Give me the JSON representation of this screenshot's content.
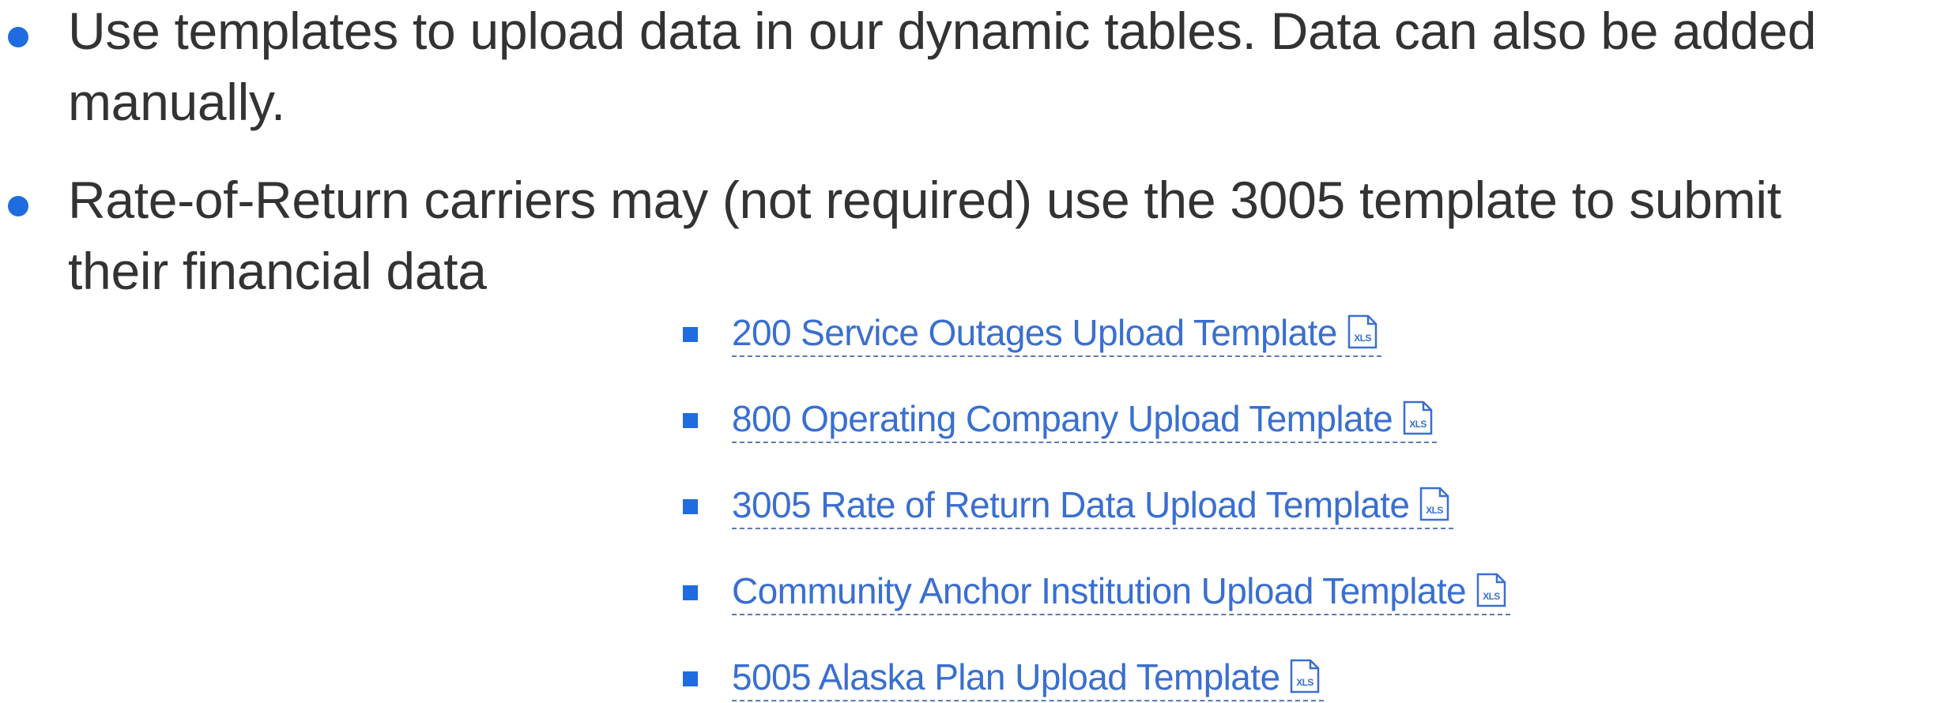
{
  "bullets": [
    {
      "line1": "Use templates to upload data in our dynamic tables. Data can also be added",
      "line2": "manually."
    },
    {
      "line1": "Rate-of-Return carriers may (not required) use the 3005 template to submit",
      "line2": "their financial data"
    }
  ],
  "links": [
    {
      "label": "200 Service Outages Upload Template",
      "icon": "xls-file-icon",
      "icon_text": "XLS"
    },
    {
      "label": "800 Operating Company Upload Template",
      "icon": "xls-file-icon",
      "icon_text": "XLS"
    },
    {
      "label": "3005 Rate of Return Data Upload Template",
      "icon": "xls-file-icon",
      "icon_text": "XLS"
    },
    {
      "label": "Community Anchor Institution Upload Template",
      "icon": "xls-file-icon",
      "icon_text": "XLS"
    },
    {
      "label": "5005 Alaska Plan Upload Template",
      "icon": "xls-file-icon",
      "icon_text": "XLS"
    }
  ],
  "colors": {
    "bullet_dot": "#1f6ce0",
    "body_text": "#333333",
    "link_text": "#3a6fd0",
    "link_underline": "#5d79b8"
  }
}
